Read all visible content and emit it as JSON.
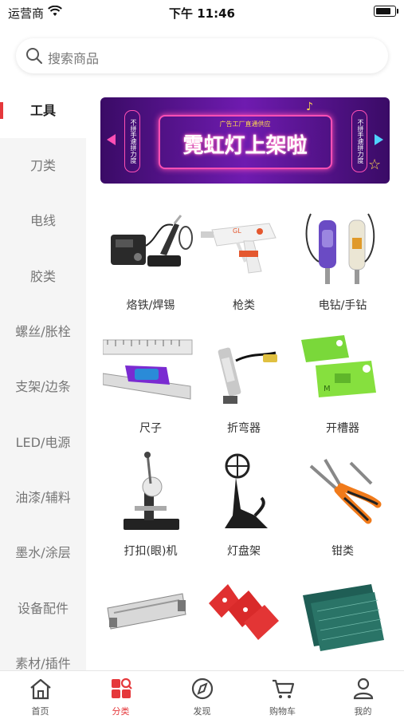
{
  "status_bar": {
    "carrier": "运营商",
    "time": "下午 11:46"
  },
  "search": {
    "placeholder": "搜索商品"
  },
  "accent_color": "#e5383b",
  "sidebar": {
    "items": [
      {
        "label": "工具",
        "active": true
      },
      {
        "label": "刀类"
      },
      {
        "label": "电线"
      },
      {
        "label": "胶类"
      },
      {
        "label": "螺丝/胀栓"
      },
      {
        "label": "支架/边条"
      },
      {
        "label": "LED/电源"
      },
      {
        "label": "油漆/辅料"
      },
      {
        "label": "墨水/涂层"
      },
      {
        "label": "设备配件"
      },
      {
        "label": "素材/插件"
      }
    ]
  },
  "banner": {
    "title": "霓虹灯上架啦",
    "subtitle": "广告工厂直通供应",
    "left_tag": "不拼手速拼力度",
    "right_tag": "不拼手速拼力度"
  },
  "products": [
    {
      "label": "烙铁/焊锡",
      "icon": "soldering-station"
    },
    {
      "label": "枪类",
      "icon": "glue-gun"
    },
    {
      "label": "电钻/手钻",
      "icon": "electric-screwdriver"
    },
    {
      "label": "尺子",
      "icon": "ruler"
    },
    {
      "label": "折弯器",
      "icon": "bending-tool"
    },
    {
      "label": "开槽器",
      "icon": "grooving-tool"
    },
    {
      "label": "打扣(眼)机",
      "icon": "eyelet-machine"
    },
    {
      "label": "灯盘架",
      "icon": "reel-stand"
    },
    {
      "label": "钳类",
      "icon": "pliers"
    },
    {
      "label": "",
      "icon": "cutter-rail"
    },
    {
      "label": "",
      "icon": "magnets"
    },
    {
      "label": "",
      "icon": "cutting-mat"
    }
  ],
  "tabbar": {
    "items": [
      {
        "label": "首页",
        "icon": "home-icon"
      },
      {
        "label": "分类",
        "icon": "category-icon",
        "active": true
      },
      {
        "label": "发现",
        "icon": "compass-icon"
      },
      {
        "label": "购物车",
        "icon": "cart-icon"
      },
      {
        "label": "我的",
        "icon": "user-icon"
      }
    ]
  }
}
